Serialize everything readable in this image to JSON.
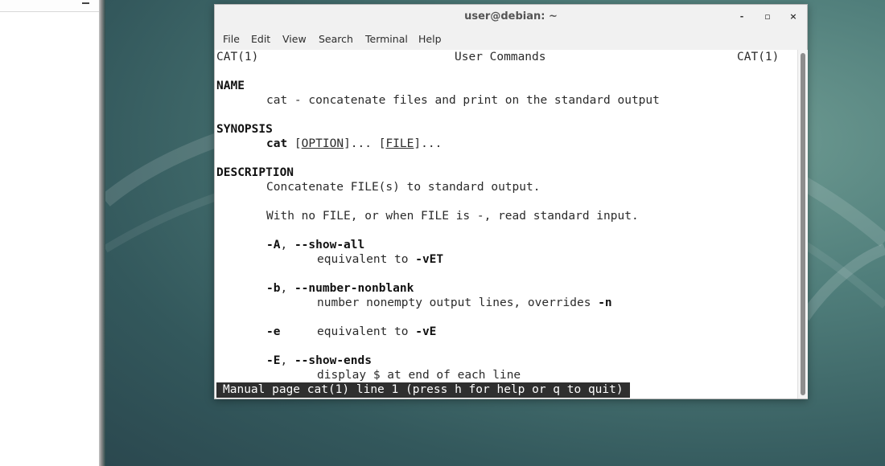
{
  "terminal": {
    "title": "user@debian: ~",
    "buttons": {
      "minimize": "-",
      "maximize": "▫",
      "close": "×"
    },
    "menu": [
      "File",
      "Edit",
      "View",
      "Search",
      "Terminal",
      "Help"
    ],
    "man": {
      "header_left": "CAT(1)",
      "header_center": "User Commands",
      "header_right": "CAT(1)",
      "name_heading": "NAME",
      "name_text": "cat - concatenate files and print on the standard output",
      "synopsis_heading": "SYNOPSIS",
      "synopsis_cmd": "cat",
      "synopsis_open1": " [",
      "synopsis_option": "OPTION",
      "synopsis_close1": "]... [",
      "synopsis_file": "FILE",
      "synopsis_close2": "]...",
      "description_heading": "DESCRIPTION",
      "desc_line1": "Concatenate FILE(s) to standard output.",
      "desc_line2": "With no FILE, or when FILE is -, read standard input.",
      "opt_A_short": "-A",
      "opt_A_long": "--show-all",
      "opt_A_desc": "equivalent to ",
      "opt_A_flag": "-vET",
      "opt_b_short": "-b",
      "opt_b_long": "--number-nonblank",
      "opt_b_desc": "number nonempty output lines, overrides ",
      "opt_b_flag": "-n",
      "opt_e_short": "-e",
      "opt_e_desc": "equivalent to ",
      "opt_e_flag": "-vE",
      "opt_E_short": "-E",
      "opt_E_long": "--show-ends",
      "opt_E_desc": "display $ at end of each line",
      "comma": ", "
    },
    "status": "Manual page cat(1) line 1 (press h for help or q to quit)"
  }
}
